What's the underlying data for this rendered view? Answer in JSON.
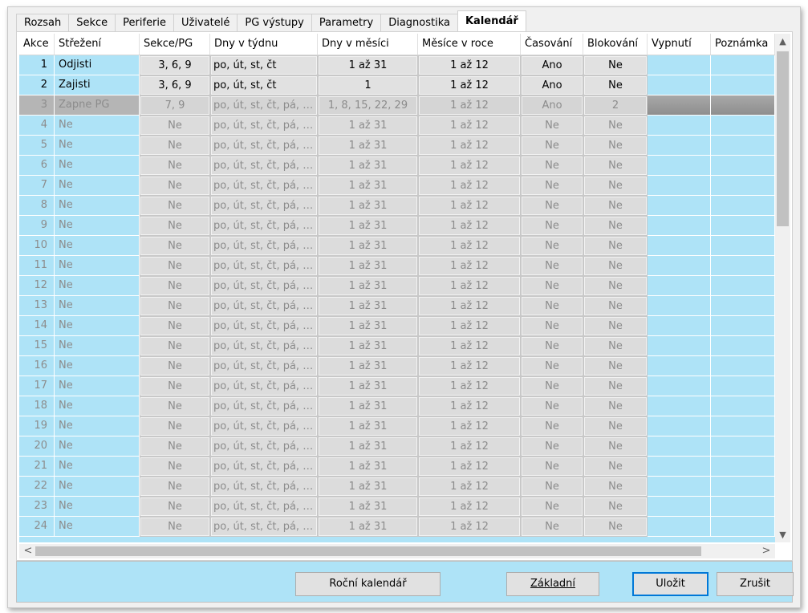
{
  "tabs": [
    "Rozsah",
    "Sekce",
    "Periferie",
    "Uživatelé",
    "PG výstupy",
    "Parametry",
    "Diagnostika",
    "Kalendář"
  ],
  "active_tab": "Kalendář",
  "columns": [
    "Akce",
    "Střežení",
    "Sekce/PG",
    "Dny v týdnu",
    "Dny v měsíci",
    "Měsíce v roce",
    "Časování",
    "Blokování",
    "Vypnutí",
    "Poznámka"
  ],
  "rows": [
    {
      "n": "1",
      "strezeni": "Odjisti",
      "sekce": "3, 6, 9",
      "dny": "po, út, st, čt",
      "mesic": "1 až 31",
      "mesice": "1 až 12",
      "casovani": "Ano",
      "blokovani": "Ne",
      "vypnuti": "",
      "poznamka": "",
      "state": "active"
    },
    {
      "n": "2",
      "strezeni": "Zajisti",
      "sekce": "3, 6, 9",
      "dny": "po, út, st, čt",
      "mesic": "1",
      "mesice": "1 až 12",
      "casovani": "Ano",
      "blokovani": "Ne",
      "vypnuti": "",
      "poznamka": "",
      "state": "active"
    },
    {
      "n": "3",
      "strezeni": "Zapne PG",
      "sekce": "7, 9",
      "dny": "po, út, st, čt, pá, s...",
      "mesic": "1, 8, 15, 22, 29",
      "mesice": "1 až 12",
      "casovani": "Ano",
      "blokovani": "2",
      "vypnuti": "",
      "poznamka": "",
      "state": "selected"
    },
    {
      "n": "4",
      "strezeni": "Ne",
      "sekce": "Ne",
      "dny": "po, út, st, čt, pá, s...",
      "mesic": "1 až 31",
      "mesice": "1 až 12",
      "casovani": "Ne",
      "blokovani": "Ne",
      "vypnuti": "",
      "poznamka": "",
      "state": "inactive"
    },
    {
      "n": "5",
      "strezeni": "Ne",
      "sekce": "Ne",
      "dny": "po, út, st, čt, pá, s...",
      "mesic": "1 až 31",
      "mesice": "1 až 12",
      "casovani": "Ne",
      "blokovani": "Ne",
      "vypnuti": "",
      "poznamka": "",
      "state": "inactive"
    },
    {
      "n": "6",
      "strezeni": "Ne",
      "sekce": "Ne",
      "dny": "po, út, st, čt, pá, s...",
      "mesic": "1 až 31",
      "mesice": "1 až 12",
      "casovani": "Ne",
      "blokovani": "Ne",
      "vypnuti": "",
      "poznamka": "",
      "state": "inactive"
    },
    {
      "n": "7",
      "strezeni": "Ne",
      "sekce": "Ne",
      "dny": "po, út, st, čt, pá, s...",
      "mesic": "1 až 31",
      "mesice": "1 až 12",
      "casovani": "Ne",
      "blokovani": "Ne",
      "vypnuti": "",
      "poznamka": "",
      "state": "inactive"
    },
    {
      "n": "8",
      "strezeni": "Ne",
      "sekce": "Ne",
      "dny": "po, út, st, čt, pá, s...",
      "mesic": "1 až 31",
      "mesice": "1 až 12",
      "casovani": "Ne",
      "blokovani": "Ne",
      "vypnuti": "",
      "poznamka": "",
      "state": "inactive"
    },
    {
      "n": "9",
      "strezeni": "Ne",
      "sekce": "Ne",
      "dny": "po, út, st, čt, pá, s...",
      "mesic": "1 až 31",
      "mesice": "1 až 12",
      "casovani": "Ne",
      "blokovani": "Ne",
      "vypnuti": "",
      "poznamka": "",
      "state": "inactive"
    },
    {
      "n": "10",
      "strezeni": "Ne",
      "sekce": "Ne",
      "dny": "po, út, st, čt, pá, s...",
      "mesic": "1 až 31",
      "mesice": "1 až 12",
      "casovani": "Ne",
      "blokovani": "Ne",
      "vypnuti": "",
      "poznamka": "",
      "state": "inactive"
    },
    {
      "n": "11",
      "strezeni": "Ne",
      "sekce": "Ne",
      "dny": "po, út, st, čt, pá, s...",
      "mesic": "1 až 31",
      "mesice": "1 až 12",
      "casovani": "Ne",
      "blokovani": "Ne",
      "vypnuti": "",
      "poznamka": "",
      "state": "inactive"
    },
    {
      "n": "12",
      "strezeni": "Ne",
      "sekce": "Ne",
      "dny": "po, út, st, čt, pá, s...",
      "mesic": "1 až 31",
      "mesice": "1 až 12",
      "casovani": "Ne",
      "blokovani": "Ne",
      "vypnuti": "",
      "poznamka": "",
      "state": "inactive"
    },
    {
      "n": "13",
      "strezeni": "Ne",
      "sekce": "Ne",
      "dny": "po, út, st, čt, pá, s...",
      "mesic": "1 až 31",
      "mesice": "1 až 12",
      "casovani": "Ne",
      "blokovani": "Ne",
      "vypnuti": "",
      "poznamka": "",
      "state": "inactive"
    },
    {
      "n": "14",
      "strezeni": "Ne",
      "sekce": "Ne",
      "dny": "po, út, st, čt, pá, s...",
      "mesic": "1 až 31",
      "mesice": "1 až 12",
      "casovani": "Ne",
      "blokovani": "Ne",
      "vypnuti": "",
      "poznamka": "",
      "state": "inactive"
    },
    {
      "n": "15",
      "strezeni": "Ne",
      "sekce": "Ne",
      "dny": "po, út, st, čt, pá, s...",
      "mesic": "1 až 31",
      "mesice": "1 až 12",
      "casovani": "Ne",
      "blokovani": "Ne",
      "vypnuti": "",
      "poznamka": "",
      "state": "inactive"
    },
    {
      "n": "16",
      "strezeni": "Ne",
      "sekce": "Ne",
      "dny": "po, út, st, čt, pá, s...",
      "mesic": "1 až 31",
      "mesice": "1 až 12",
      "casovani": "Ne",
      "blokovani": "Ne",
      "vypnuti": "",
      "poznamka": "",
      "state": "inactive"
    },
    {
      "n": "17",
      "strezeni": "Ne",
      "sekce": "Ne",
      "dny": "po, út, st, čt, pá, s...",
      "mesic": "1 až 31",
      "mesice": "1 až 12",
      "casovani": "Ne",
      "blokovani": "Ne",
      "vypnuti": "",
      "poznamka": "",
      "state": "inactive"
    },
    {
      "n": "18",
      "strezeni": "Ne",
      "sekce": "Ne",
      "dny": "po, út, st, čt, pá, s...",
      "mesic": "1 až 31",
      "mesice": "1 až 12",
      "casovani": "Ne",
      "blokovani": "Ne",
      "vypnuti": "",
      "poznamka": "",
      "state": "inactive"
    },
    {
      "n": "19",
      "strezeni": "Ne",
      "sekce": "Ne",
      "dny": "po, út, st, čt, pá, s...",
      "mesic": "1 až 31",
      "mesice": "1 až 12",
      "casovani": "Ne",
      "blokovani": "Ne",
      "vypnuti": "",
      "poznamka": "",
      "state": "inactive"
    },
    {
      "n": "20",
      "strezeni": "Ne",
      "sekce": "Ne",
      "dny": "po, út, st, čt, pá, s...",
      "mesic": "1 až 31",
      "mesice": "1 až 12",
      "casovani": "Ne",
      "blokovani": "Ne",
      "vypnuti": "",
      "poznamka": "",
      "state": "inactive"
    },
    {
      "n": "21",
      "strezeni": "Ne",
      "sekce": "Ne",
      "dny": "po, út, st, čt, pá, s...",
      "mesic": "1 až 31",
      "mesice": "1 až 12",
      "casovani": "Ne",
      "blokovani": "Ne",
      "vypnuti": "",
      "poznamka": "",
      "state": "inactive"
    },
    {
      "n": "22",
      "strezeni": "Ne",
      "sekce": "Ne",
      "dny": "po, út, st, čt, pá, s...",
      "mesic": "1 až 31",
      "mesice": "1 až 12",
      "casovani": "Ne",
      "blokovani": "Ne",
      "vypnuti": "",
      "poznamka": "",
      "state": "inactive"
    },
    {
      "n": "23",
      "strezeni": "Ne",
      "sekce": "Ne",
      "dny": "po, út, st, čt, pá, s...",
      "mesic": "1 až 31",
      "mesice": "1 až 12",
      "casovani": "Ne",
      "blokovani": "Ne",
      "vypnuti": "",
      "poznamka": "",
      "state": "inactive"
    },
    {
      "n": "24",
      "strezeni": "Ne",
      "sekce": "Ne",
      "dny": "po, út, st, čt, pá, s...",
      "mesic": "1 až 31",
      "mesice": "1 až 12",
      "casovani": "Ne",
      "blokovani": "Ne",
      "vypnuti": "",
      "poznamka": "",
      "state": "inactive"
    }
  ],
  "buttons": {
    "rocni": "Roční kalendář",
    "zakladni": "Základní",
    "ulozit": "Uložit",
    "zrusit": "Zrušit"
  },
  "colors": {
    "grid_background": "#aee3f7",
    "selected_row": "#b5b5b5",
    "default_button_border": "#0078d7"
  },
  "icons": {
    "scroll_up": "▲",
    "scroll_down": "▼",
    "scroll_left": "<",
    "scroll_right": ">"
  }
}
